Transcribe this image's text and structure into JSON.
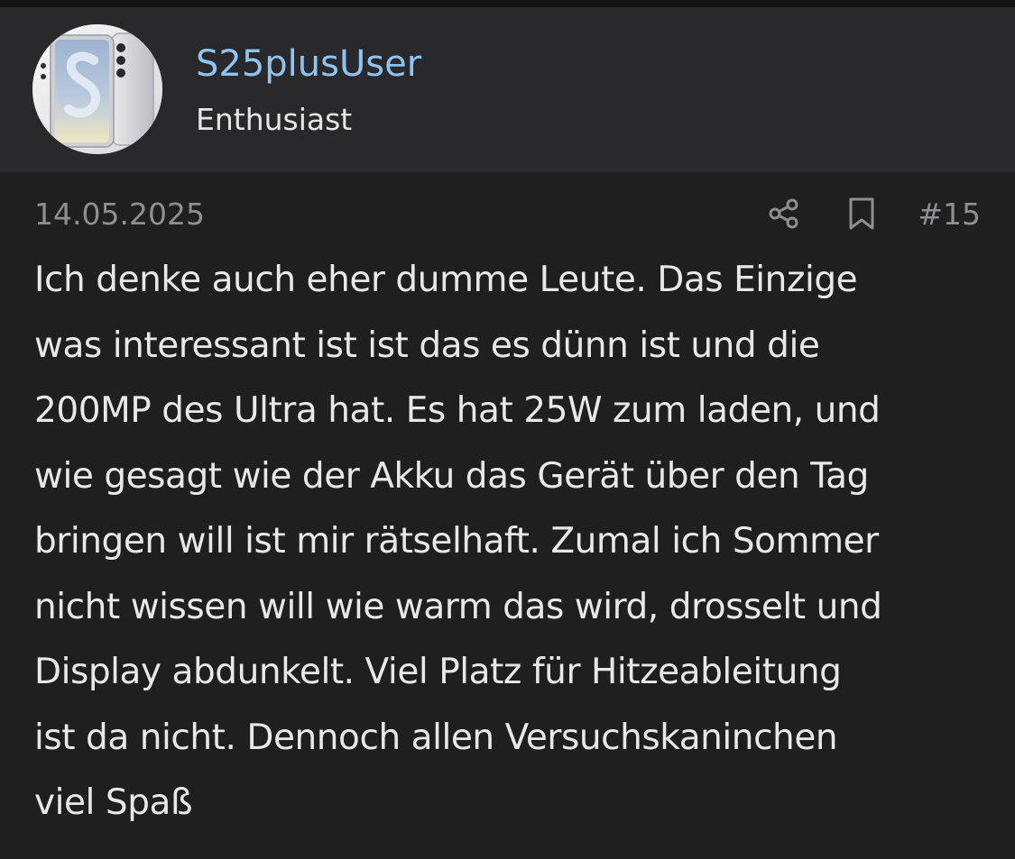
{
  "author": {
    "username": "S25plusUser",
    "rank": "Enthusiast"
  },
  "post": {
    "date": "14.05.2025",
    "number": "#15",
    "lines": [
      "Ich denke auch eher dumme Leute. Das Einzige",
      "was interessant ist ist das es dünn ist und die",
      "200MP des Ultra hat. Es hat 25W zum laden, und",
      "wie gesagt wie der Akku das Gerät über den Tag",
      "bringen will ist mir rätselhaft. Zumal ich Sommer",
      "nicht wissen will wie warm das wird, drosselt und",
      "Display abdunkelt. Viel Platz für Hitzeableitung",
      "ist da nicht. Dennoch allen Versuchskaninchen",
      "viel Spaß"
    ]
  },
  "icons": {
    "share": "share-icon",
    "bookmark": "bookmark-icon"
  },
  "colors": {
    "background": "#1f1f20",
    "header_background": "#29292b",
    "username": "#8ec3f3",
    "text": "#e8e8e8",
    "muted": "#8f8f91"
  }
}
